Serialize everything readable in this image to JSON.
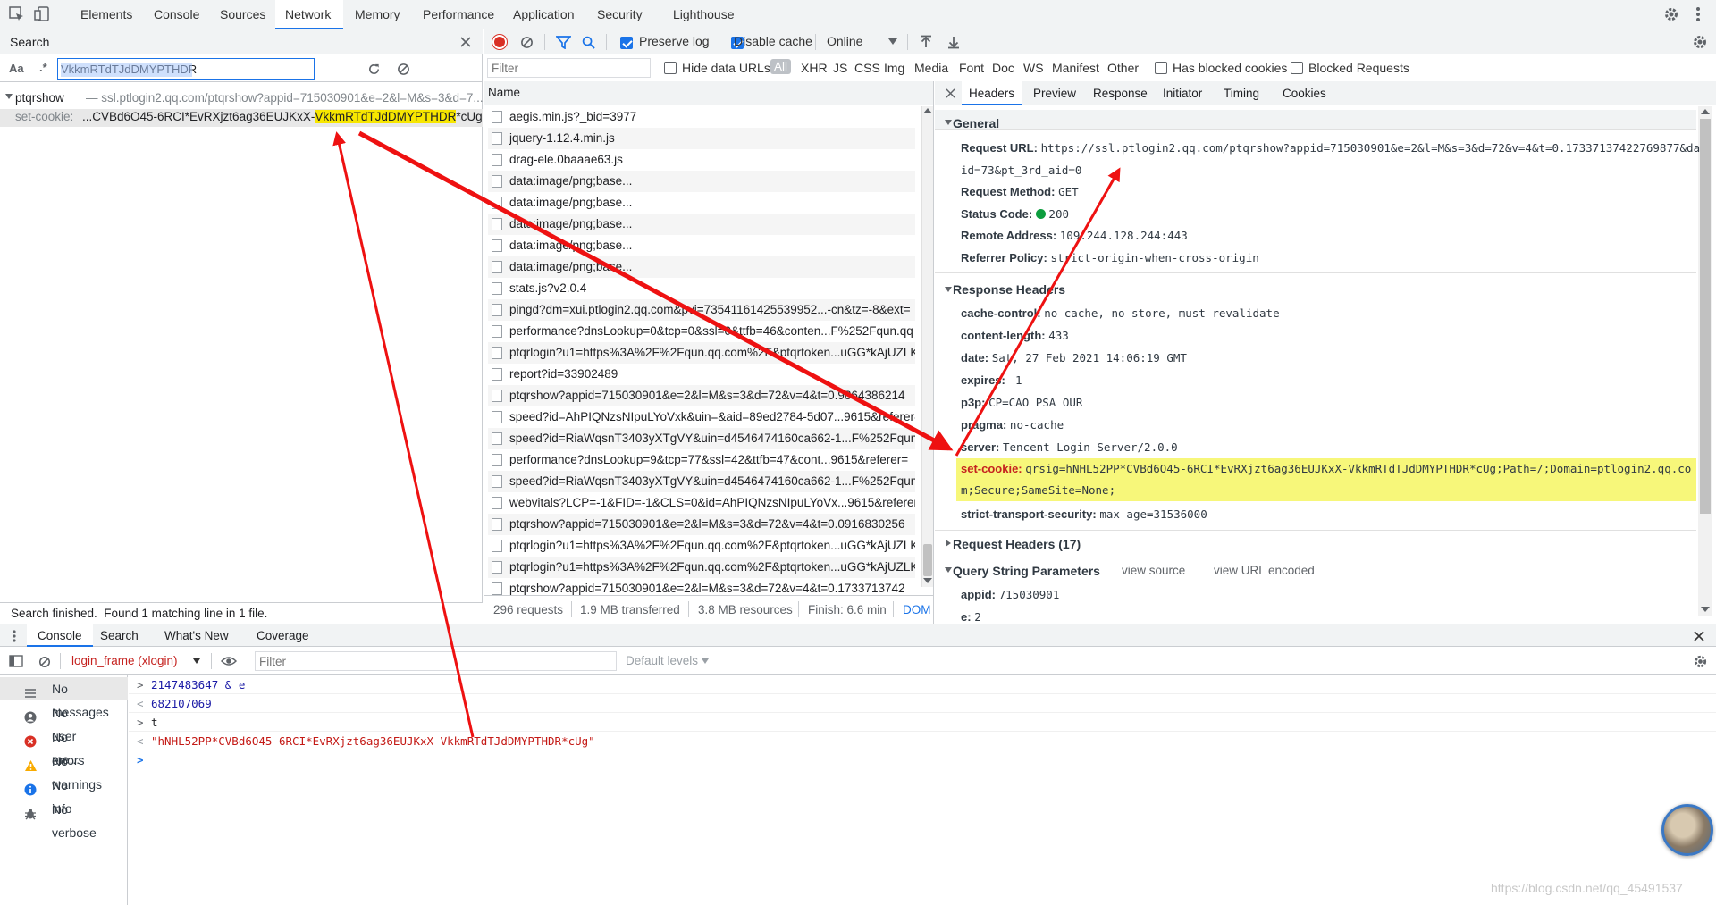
{
  "toptabs": [
    "Elements",
    "Console",
    "Sources",
    "Network",
    "Memory",
    "Performance",
    "Application",
    "Security",
    "Lighthouse"
  ],
  "search": {
    "title": "Search",
    "value": "VkkmRTdTJdDMYPTHDR",
    "aa": "Aa",
    "regex": ".*",
    "result_file": "ptqrshow",
    "result_url": "— ssl.ptlogin2.qq.com/ptqrshow?appid=715030901&e=2&l=M&s=3&d=7...",
    "result_key": "set-cookie:",
    "result_pre": "...CVBd6O45-6RCI*EvRXjzt6ag36EUJKxX-",
    "result_match": "VkkmRTdTJdDMYPTHDR",
    "result_post": "*cUg;Pat...",
    "status": "Search finished.  Found 1 matching line in 1 file."
  },
  "network": {
    "preserve_log": "Preserve log",
    "disable_cache": "Disable cache",
    "throttle": "Online",
    "filter_placeholder": "Filter",
    "hide_data_urls": "Hide data URLs",
    "types": [
      "All",
      "XHR",
      "JS",
      "CSS",
      "Img",
      "Media",
      "Font",
      "Doc",
      "WS",
      "Manifest",
      "Other"
    ],
    "has_blocked": "Has blocked cookies",
    "blocked_requests": "Blocked Requests",
    "name_col": "Name",
    "rows": [
      "aegis.min.js?_bid=3977",
      "jquery-1.12.4.min.js",
      "drag-ele.0baaae63.js",
      "data:image/png;base...",
      "data:image/png;base...",
      "data:image/png;base...",
      "data:image/png;base...",
      "data:image/png;base...",
      "stats.js?v2.0.4",
      "pingd?dm=xui.ptlogin2.qq.com&pvi=73541161425539952...-cn&tz=-8&ext=",
      "performance?dnsLookup=0&tcp=0&ssl=0&ttfb=46&conten...F%252Fqun.qq",
      "ptqrlogin?u1=https%3A%2F%2Fqun.qq.com%2F&ptqrtoken...uGG*kAjUZLKg",
      "report?id=33902489",
      "ptqrshow?appid=715030901&e=2&l=M&s=3&d=72&v=4&t=0.9864386214",
      "speed?id=AhPIQNzsNIpuLYoVxk&uin=&aid=89ed2784-5d07...9615&referer=",
      "speed?id=RiaWqsnT3403yXTgVY&uin=d4546474160ca662-1...F%252Fqun.qq",
      "performance?dnsLookup=9&tcp=77&ssl=42&ttfb=47&cont...9615&referer=",
      "speed?id=RiaWqsnT3403yXTgVY&uin=d4546474160ca662-1...F%252Fqun.qq",
      "webvitals?LCP=-1&FID=-1&CLS=0&id=AhPIQNzsNIpuLYoVx...9615&referer=",
      "ptqrshow?appid=715030901&e=2&l=M&s=3&d=72&v=4&t=0.0916830256",
      "ptqrlogin?u1=https%3A%2F%2Fqun.qq.com%2F&ptqrtoken...uGG*kAjUZLKg",
      "ptqrlogin?u1=https%3A%2F%2Fqun.qq.com%2F&ptqrtoken...uGG*kAjUZLKg",
      "ptqrshow?appid=715030901&e=2&l=M&s=3&d=72&v=4&t=0.1733713742"
    ],
    "status": [
      "296 requests",
      "1.9 MB transferred",
      "3.8 MB resources",
      "Finish: 6.6 min",
      "DOM"
    ]
  },
  "detail": {
    "tabs": [
      "Headers",
      "Preview",
      "Response",
      "Initiator",
      "Timing",
      "Cookies"
    ],
    "general": "General",
    "general_rows": [
      [
        "Request URL:",
        "https://ssl.ptlogin2.qq.com/ptqrshow?appid=715030901&e=2&l=M&s=3&d=72&v=4&t=0.17337137422769877&da"
      ],
      [
        "",
        "id=73&pt_3rd_aid=0"
      ],
      [
        "Request Method:",
        "GET"
      ],
      [
        "Status Code:",
        "200"
      ],
      [
        "Remote Address:",
        "109.244.128.244:443"
      ],
      [
        "Referrer Policy:",
        "strict-origin-when-cross-origin"
      ]
    ],
    "response_headers": "Response Headers",
    "resp_rows": [
      [
        "cache-control:",
        "no-cache, no-store, must-revalidate"
      ],
      [
        "content-length:",
        "433"
      ],
      [
        "date:",
        "Sat, 27 Feb 2021 14:06:19 GMT"
      ],
      [
        "expires:",
        "-1"
      ],
      [
        "p3p:",
        "CP=CAO PSA OUR"
      ],
      [
        "pragma:",
        "no-cache"
      ],
      [
        "server:",
        "Tencent Login Server/2.0.0"
      ]
    ],
    "setcookie_key": "set-cookie:",
    "setcookie_1": "qrsig=hNHL52PP*CVBd6O45-6RCI*EvRXjzt6ag36EUJKxX-VkkmRTdTJdDMYPTHDR*cUg;Path=/;Domain=ptlogin2.qq.co",
    "setcookie_2": "m;Secure;SameSite=None;",
    "sts_key": "strict-transport-security:",
    "sts_val": "max-age=31536000",
    "request_headers": "Request Headers (17)",
    "qsp": "Query String Parameters",
    "view_source": "view source",
    "view_url": "view URL encoded",
    "params": [
      [
        "appid:",
        "715030901"
      ],
      [
        "e:",
        "2"
      ]
    ]
  },
  "drawer": {
    "tabs": [
      "Console",
      "Search",
      "What's New",
      "Coverage"
    ],
    "context": "login_frame (xlogin)",
    "filter_placeholder": "Filter",
    "levels": "Default levels",
    "sidebar": [
      "No messages",
      "No user me...",
      "No errors",
      "No warnings",
      "No info",
      "No verbose"
    ],
    "lines": [
      "2147483647 & e",
      "682107069",
      "t",
      "\"hNHL52PP*CVBd6O45-6RCI*EvRXjzt6ag36EUJKxX-VkkmRTdTJdDMYPTHDR*cUg\""
    ],
    "watermark": "https://blog.csdn.net/qq_45491537"
  },
  "colors": {
    "accent": "#1a73e8",
    "highlight": "#f7f77a",
    "arrow": "#ee1111"
  }
}
